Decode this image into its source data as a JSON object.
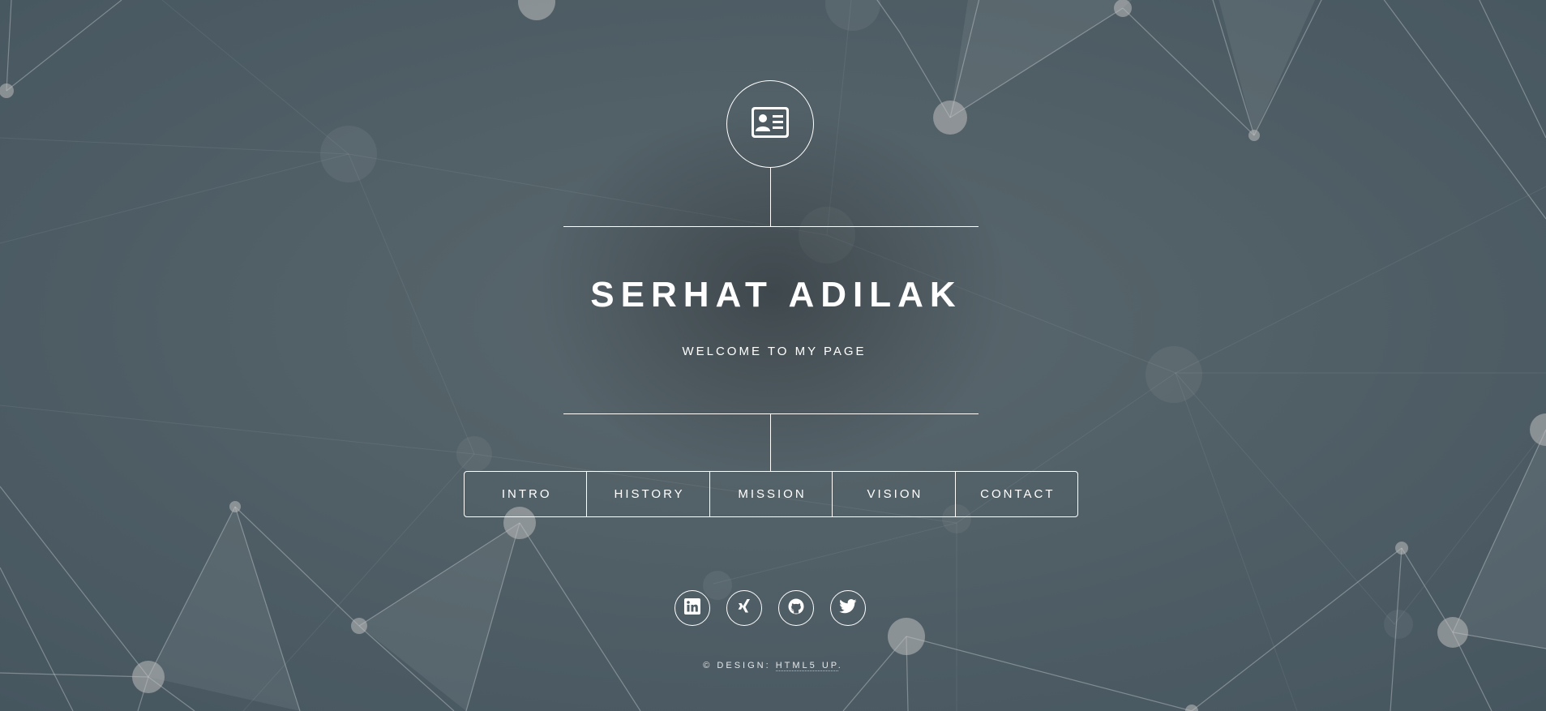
{
  "header": {
    "logo_icon": "id-card-icon",
    "title": "SERHAT ADILAK",
    "subtitle": "WELCOME TO MY PAGE"
  },
  "nav": {
    "items": [
      {
        "label": "INTRO"
      },
      {
        "label": "HISTORY"
      },
      {
        "label": "MISSION"
      },
      {
        "label": "VISION"
      },
      {
        "label": "CONTACT"
      }
    ]
  },
  "socials": [
    {
      "icon": "linkedin-icon"
    },
    {
      "icon": "xing-icon"
    },
    {
      "icon": "github-icon"
    },
    {
      "icon": "twitter-icon"
    }
  ],
  "footer": {
    "prefix": "© DESIGN: ",
    "link": "HTML5 UP",
    "suffix": "."
  },
  "colors": {
    "background": "#4f5e66",
    "foreground": "#ffffff"
  }
}
